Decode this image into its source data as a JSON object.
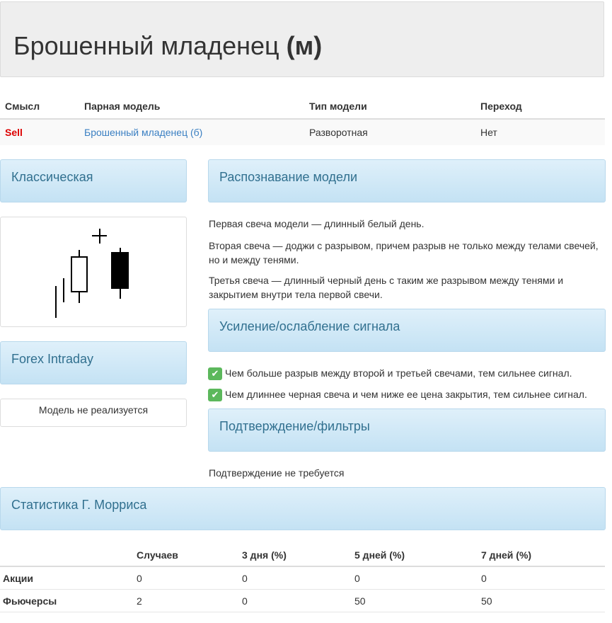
{
  "page": {
    "title_main": "Брошенный младенец",
    "title_suffix": "(м)"
  },
  "info_table": {
    "headers": [
      "Смысл",
      "Парная модель",
      "Тип модели",
      "Переход"
    ],
    "row": {
      "meaning": "Sell",
      "pair_model": "Брошенный младенец (б)",
      "model_type": "Разворотная",
      "transition": "Нет"
    }
  },
  "classic": {
    "heading": "Классическая"
  },
  "forex": {
    "heading": "Forex Intraday",
    "note": "Модель не реализуется"
  },
  "recognition": {
    "heading": "Распознавание модели",
    "paragraphs": [
      "Первая свеча модели — длинный белый день.",
      "Вторая свеча — доджи с разрывом, причем разрыв не только между телами свечей, но и между тенями.",
      "Третья свеча — длинный черный день с таким же разрывом между тенями и закрытием внутри тела первой свечи."
    ]
  },
  "signal": {
    "heading": "Усиление/ослабление сигнала",
    "items": [
      "Чем больше разрыв между второй и третьей свечами, тем сильнее сигнал.",
      "Чем длиннее черная свеча и чем ниже ее цена закрытия, тем сильнее сигнал."
    ]
  },
  "confirm": {
    "heading": "Подтверждение/фильтры",
    "text": "Подтверждение не требуется"
  },
  "stats": {
    "heading": "Статистика Г. Морриса",
    "headers": [
      "",
      "Случаев",
      "3 дня (%)",
      "5 дней (%)",
      "7 дней (%)"
    ],
    "rows": [
      {
        "label": "Акции",
        "values": [
          "0",
          "0",
          "0",
          "0"
        ]
      },
      {
        "label": "Фьючерсы",
        "values": [
          "2",
          "0",
          "50",
          "50"
        ]
      }
    ]
  },
  "icons": {
    "check": "check-icon"
  },
  "colors": {
    "sell": "#dd0000",
    "link": "#3a7fc2",
    "panel_text": "#31708f",
    "check_bg": "#5cb85c"
  }
}
